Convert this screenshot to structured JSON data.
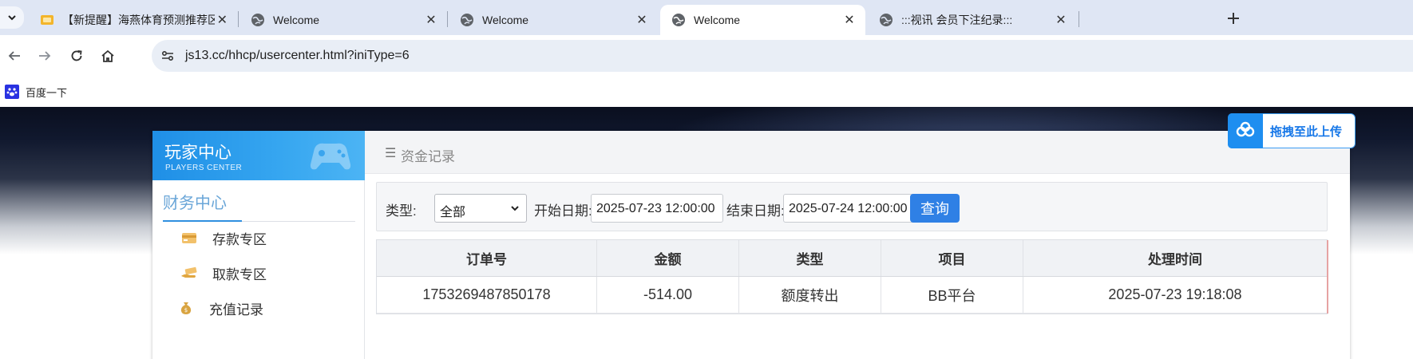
{
  "browser": {
    "tabs": [
      {
        "title": "【新提醒】海燕体育预测推荐区",
        "favicon": "folder-chat-icon",
        "active": false
      },
      {
        "title": "Welcome",
        "favicon": "globe-icon",
        "active": false
      },
      {
        "title": "Welcome",
        "favicon": "globe-icon",
        "active": false
      },
      {
        "title": "Welcome",
        "favicon": "globe-icon",
        "active": true
      },
      {
        "title": ":::视讯 会员下注纪录:::",
        "favicon": "globe-icon",
        "active": false
      }
    ],
    "url": "js13.cc/hhcp/usercenter.html?iniType=6",
    "bookmark": "百度一下"
  },
  "upload_widget": {
    "label": "拖拽至此上传"
  },
  "sidebar": {
    "title_cn": "玩家中心",
    "title_en": "PLAYERS CENTER",
    "section": "财务中心",
    "items": [
      {
        "label": "存款专区",
        "icon": "wallet-icon"
      },
      {
        "label": "取款专区",
        "icon": "hand-cash-icon"
      },
      {
        "label": "充值记录",
        "icon": "money-bag-icon"
      }
    ]
  },
  "content": {
    "breadcrumb": "资金记录",
    "filter": {
      "type_label": "类型:",
      "type_value": "全部",
      "start_label": "开始日期:",
      "start_value": "2025-07-23 12:00:00",
      "end_label": "结束日期:",
      "end_value": "2025-07-24 12:00:00",
      "query_button": "查询"
    },
    "table": {
      "headers": [
        "订单号",
        "金额",
        "类型",
        "项目",
        "处理时间"
      ],
      "rows": [
        [
          "1753269487850178",
          "-514.00",
          "额度转出",
          "BB平台",
          "2025-07-23 19:18:08"
        ]
      ]
    }
  },
  "colors": {
    "accent": "#2f80e5",
    "sidebar_header": "#2596eb",
    "section_text": "#6aa6d8"
  }
}
